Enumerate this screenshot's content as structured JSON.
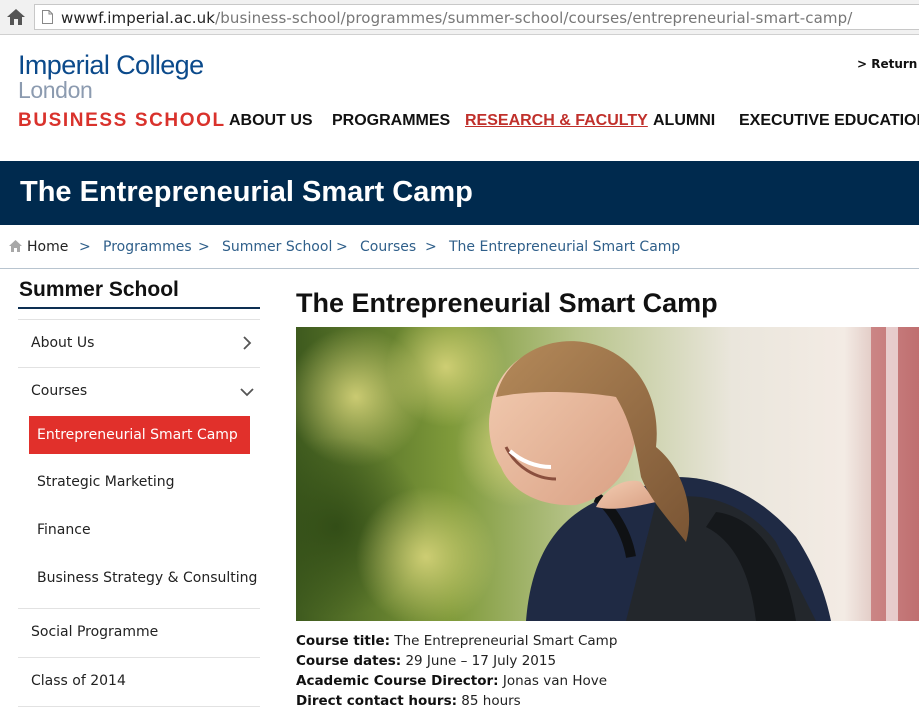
{
  "browser": {
    "url_host": "wwwf.imperial.ac.uk",
    "url_path": "/business-school/programmes/summer-school/courses/entrepreneurial-smart-camp/"
  },
  "header": {
    "logo_line1": "Imperial College",
    "logo_line2": "London",
    "logo_line3": "BUSINESS SCHOOL",
    "return_link": "> Return to",
    "nav": [
      "ABOUT US",
      "PROGRAMMES",
      "RESEARCH & FACULTY",
      "ALUMNI",
      "EXECUTIVE EDUCATION"
    ],
    "active_nav": "RESEARCH & FACULTY"
  },
  "banner": {
    "title": "The Entrepreneurial Smart Camp"
  },
  "breadcrumb": {
    "items": [
      "Home",
      "Programmes",
      "Summer School",
      "Courses",
      "The Entrepreneurial Smart Camp"
    ],
    "separator": ">"
  },
  "sidebar": {
    "title": "Summer School",
    "items": [
      {
        "label": "About Us"
      },
      {
        "label": "Courses"
      },
      {
        "label": "Social Programme"
      },
      {
        "label": "Class of 2014"
      }
    ],
    "course_items": [
      {
        "label": "Entrepreneurial Smart Camp"
      },
      {
        "label": "Strategic Marketing"
      },
      {
        "label": "Finance"
      },
      {
        "label": "Business Strategy & Consulting"
      }
    ]
  },
  "main": {
    "title": "The Entrepreneurial Smart Camp",
    "details": [
      {
        "label": "Course title:",
        "value": " The Entrepreneurial Smart Camp"
      },
      {
        "label": "Course dates:",
        "value": " 29 June – 17 July 2015"
      },
      {
        "label": "Academic Course Director:",
        "value": " Jonas van Hove"
      },
      {
        "label": "Direct contact hours:",
        "value": " 85 hours"
      }
    ]
  },
  "colors": {
    "brand_blue": "#0b4a8b",
    "banner_navy": "#002a4e",
    "brand_red": "#d9322c",
    "active_sidebar": "#e1302b",
    "link_blue": "#2f5f8a"
  }
}
